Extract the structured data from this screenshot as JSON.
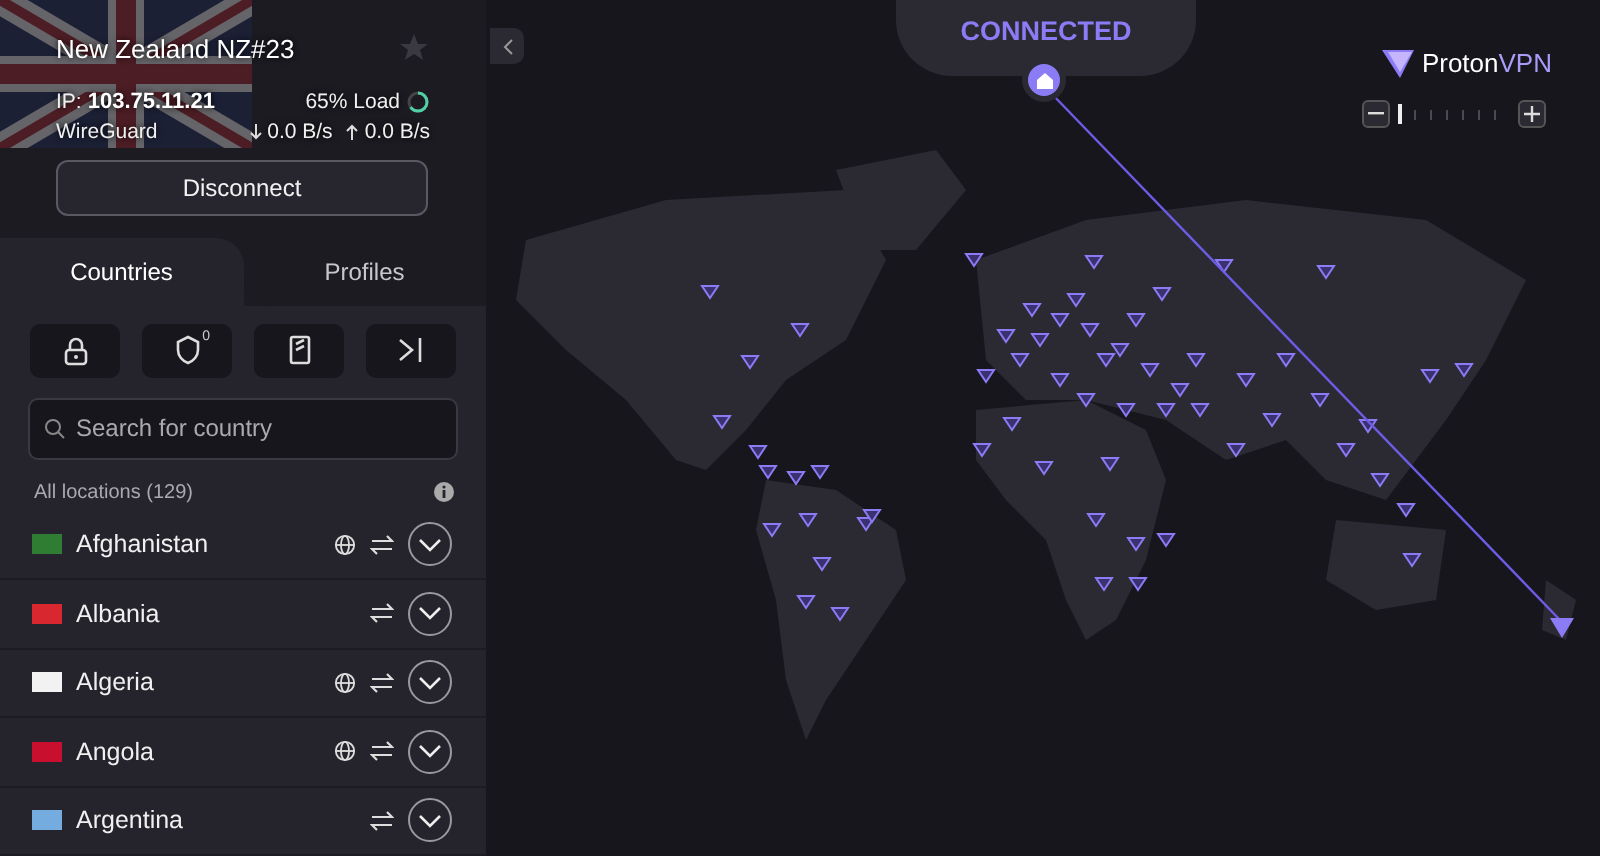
{
  "connection": {
    "server": "New Zealand NZ#23",
    "ip_label": "IP:",
    "ip": "103.75.11.21",
    "load": {
      "text": "65% Load",
      "level": 0.65
    },
    "protocol": "WireGuard",
    "download": "0.0 B/s",
    "upload": "0.0 B/s",
    "favorite": false
  },
  "disconnect_button": "Disconnect",
  "tabs": [
    {
      "label": "Countries",
      "selected": true
    },
    {
      "label": "Profiles",
      "selected": false
    }
  ],
  "toolbar": [
    {
      "kind": "lock"
    },
    {
      "kind": "shield",
      "badge": "0"
    },
    {
      "kind": "card"
    },
    {
      "kind": "arrow"
    }
  ],
  "search": {
    "placeholder": "Search for country"
  },
  "list_header": "All locations (129)",
  "countries": [
    {
      "name": "Afghanistan",
      "color": "#2e7d32",
      "globe": true,
      "switch": true
    },
    {
      "name": "Albania",
      "color": "#d8272e",
      "globe": false,
      "switch": true
    },
    {
      "name": "Algeria",
      "color": "#f2f2f2",
      "globe": true,
      "switch": true
    },
    {
      "name": "Angola",
      "color": "#c8102e",
      "globe": true,
      "switch": true
    },
    {
      "name": "Argentina",
      "color": "#74acdf",
      "globe": false,
      "switch": true
    }
  ],
  "map": {
    "status": "CONNECTED",
    "brand_primary": "Proton",
    "brand_secondary": "VPN",
    "zoom": {
      "level": 0
    }
  }
}
